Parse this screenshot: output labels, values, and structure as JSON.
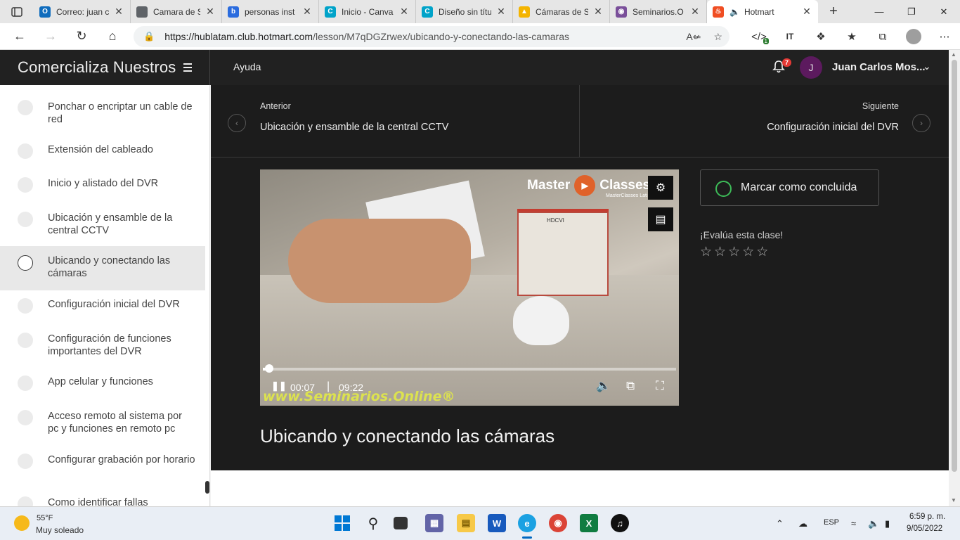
{
  "browser": {
    "tabs": [
      {
        "title": "Correo: juan c",
        "color": "#0f6cbd",
        "glyph": "O"
      },
      {
        "title": "Camara de Se",
        "color": "#5f6368",
        "glyph": ""
      },
      {
        "title": "personas inst",
        "color": "#2b6cde",
        "glyph": "b"
      },
      {
        "title": "Inicio - Canva",
        "color": "#00a3c9",
        "glyph": "C"
      },
      {
        "title": "Diseño sin títu",
        "color": "#00a3c9",
        "glyph": "C"
      },
      {
        "title": "Cámaras de S",
        "color": "#f4b400",
        "glyph": "▲"
      },
      {
        "title": "Seminarios.O",
        "color": "#7a4f9a",
        "glyph": "◉"
      },
      {
        "title": "Hotmart",
        "color": "#f04e23",
        "glyph": "♨"
      }
    ],
    "url_host": "https://hublatam.club.hotmart.com",
    "url_path": "/lesson/M7qDGZrwex/ubicando-y-conectando-las-camaras",
    "extension_badge": "1"
  },
  "header": {
    "course_title": "Comercializa Nuestros",
    "help_label": "Ayuda",
    "notification_count": "7",
    "user_initial": "J",
    "user_name": "Juan Carlos Mos..."
  },
  "sidebar": {
    "lessons": [
      {
        "label": "Ponchar o encriptar un cable de red",
        "active": false
      },
      {
        "label": "Extensión del cableado",
        "active": false
      },
      {
        "label": "Inicio y alistado del DVR",
        "active": false
      },
      {
        "label": "Ubicación y ensamble de la central CCTV",
        "active": false
      },
      {
        "label": "Ubicando y conectando las cámaras",
        "active": true
      },
      {
        "label": "Configuración inicial del DVR",
        "active": false
      },
      {
        "label": "Configuración de funciones importantes del DVR",
        "active": false
      },
      {
        "label": "App celular y funciones",
        "active": false
      },
      {
        "label": "Acceso remoto al sistema por pc y funciones en remoto pc",
        "active": false
      },
      {
        "label": "Configurar grabación por horario",
        "active": false
      },
      {
        "label": "Como identificar fallas",
        "active": false
      }
    ]
  },
  "navigation": {
    "prev_caption": "Anterior",
    "prev_title": "Ubicación y ensamble de la central CCTV",
    "next_caption": "Siguiente",
    "next_title": "Configuración inicial del DVR"
  },
  "video": {
    "current_time": "00:07",
    "duration": "09:22",
    "progress_fraction": 0.012,
    "logo_text": "Master",
    "logo_text2": "Classes",
    "logo_sub": "MasterClasses Lati",
    "watermark": "www.Seminarios.Online®",
    "box_label": "HDCVI"
  },
  "lesson": {
    "complete_label": "Marcar como concluida",
    "rate_label": "¡Evalúa esta clase!",
    "stars_total": 5,
    "stars_filled": 0,
    "title": "Ubicando y conectando las cámaras"
  },
  "taskbar": {
    "temperature": "55°F",
    "weather": "Muy soleado",
    "language": "ESP",
    "time": "6:59 p. m.",
    "date": "9/05/2022"
  },
  "colors": {
    "header_bg": "#212121",
    "main_bg": "#1c1c1c",
    "complete_ring": "#3dbb58",
    "notification_badge": "#e53935",
    "avatar_bg": "#5c1a5e"
  }
}
